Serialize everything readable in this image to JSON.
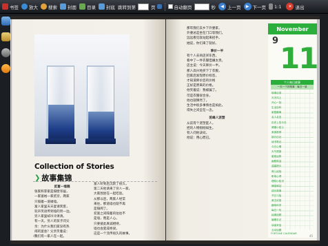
{
  "toolbar": {
    "bookmark": "书签",
    "zoom_in": "放大",
    "search": "搜索",
    "cover": "封面",
    "toc": "目录",
    "back_cover": "封底",
    "goto_prefix": "跳转到第",
    "goto_suffix": "页",
    "autoflip": "自动翻页",
    "seconds": "秒",
    "prev": "上一页",
    "next": "下一页",
    "ratio": "1:1",
    "exit": "退出"
  },
  "left_page": {
    "title_en": "Collection of Stories",
    "title_cn": "故事集锦",
    "col1_heading": "贫富一墙隔",
    "col1": [
      "张家和李家是隔壁邻居，",
      "一家富裕一家贫穷，两家",
      "只隔着一道矮墙。",
      "富人家里天天宴请宾客，",
      "欢声笑语传到墙的另一边，",
      "穷人家里却冷冷清清。",
      "有一天，穷人的孩子问父",
      "亲：为什么我们家没有热",
      "闹的宴会？父亲笑着说：",
      "我们有一家人在一起。"
    ],
    "col2": [
      "富人听到后沉默了很久，",
      "第二天他请来了穷人一家，",
      "大家围坐在一起吃饭。",
      "从那以后，两家人经常",
      "来往，那道墙也就不再",
      "是隔阂了。",
      "贫富之间隔着的往往不",
      "是墙，而是人心。",
      "只要彼此真诚相待，",
      "墙也会变成桥梁。",
      "这是一个流传很久的故事。"
    ],
    "page_number": "44"
  },
  "right_page": {
    "col_top": [
      "那年我们去乡下外婆家，",
      "外婆总是坐在门口等我们，",
      "远远看见就站起来招手。",
      "她说，你们来了就好。"
    ],
    "heading2": "降价一半",
    "col_mid": [
      "有个人去商店买东西，",
      "看中了一件衣服但嫌太贵。",
      "店主说：今天降价一半。",
      "那人高兴地买下了衣服，",
      "回家后发现原价标签，",
      "才知道降价后的价格",
      "正好是原来的价格。",
      "他笑着说：我被骗了。",
      "可是衣服很合身，",
      "他也就释然了。",
      "生活中很多事情也是如此，",
      "得失之间全在一念。"
    ],
    "heading3": "驼峰人泥塑",
    "col_bot": [
      "从前有个泥塑匠人，",
      "捏的人物栩栩如生。",
      "有人问他诀窍，",
      "他说：用心而已。"
    ],
    "page_number": "45"
  },
  "calendar": {
    "month": "November",
    "small_day": "9",
    "big_day": "11",
    "band_top": "个人每日故事",
    "band_sub": "一天一个好故事 · 每日一读",
    "list": [
      "故事目录",
      "天天向上",
      "开心一刻",
      "生活百科",
      "家庭趣事",
      "名人名言",
      "历史上的今天",
      "健康小贴士",
      "美食推荐",
      "旅行日记",
      "读书笔记",
      "今日心情",
      "天气预报",
      "星座运势",
      "幽默笑话",
      "温馨提示",
      "育儿经验",
      "职场心得",
      "理财小知识",
      "情感驿站",
      "成长故事",
      "节日习俗",
      "美文欣赏",
      "趣味科学",
      "每日一句",
      "经典回顾",
      "编辑手记",
      "读者来信",
      "互动话题"
    ],
    "footer": "FORTUNE CALENDAR"
  },
  "colors": {
    "accent_green": "#2bae3b",
    "toolbar_bg": "#2a2f35",
    "exit_red": "#d63a2a"
  }
}
